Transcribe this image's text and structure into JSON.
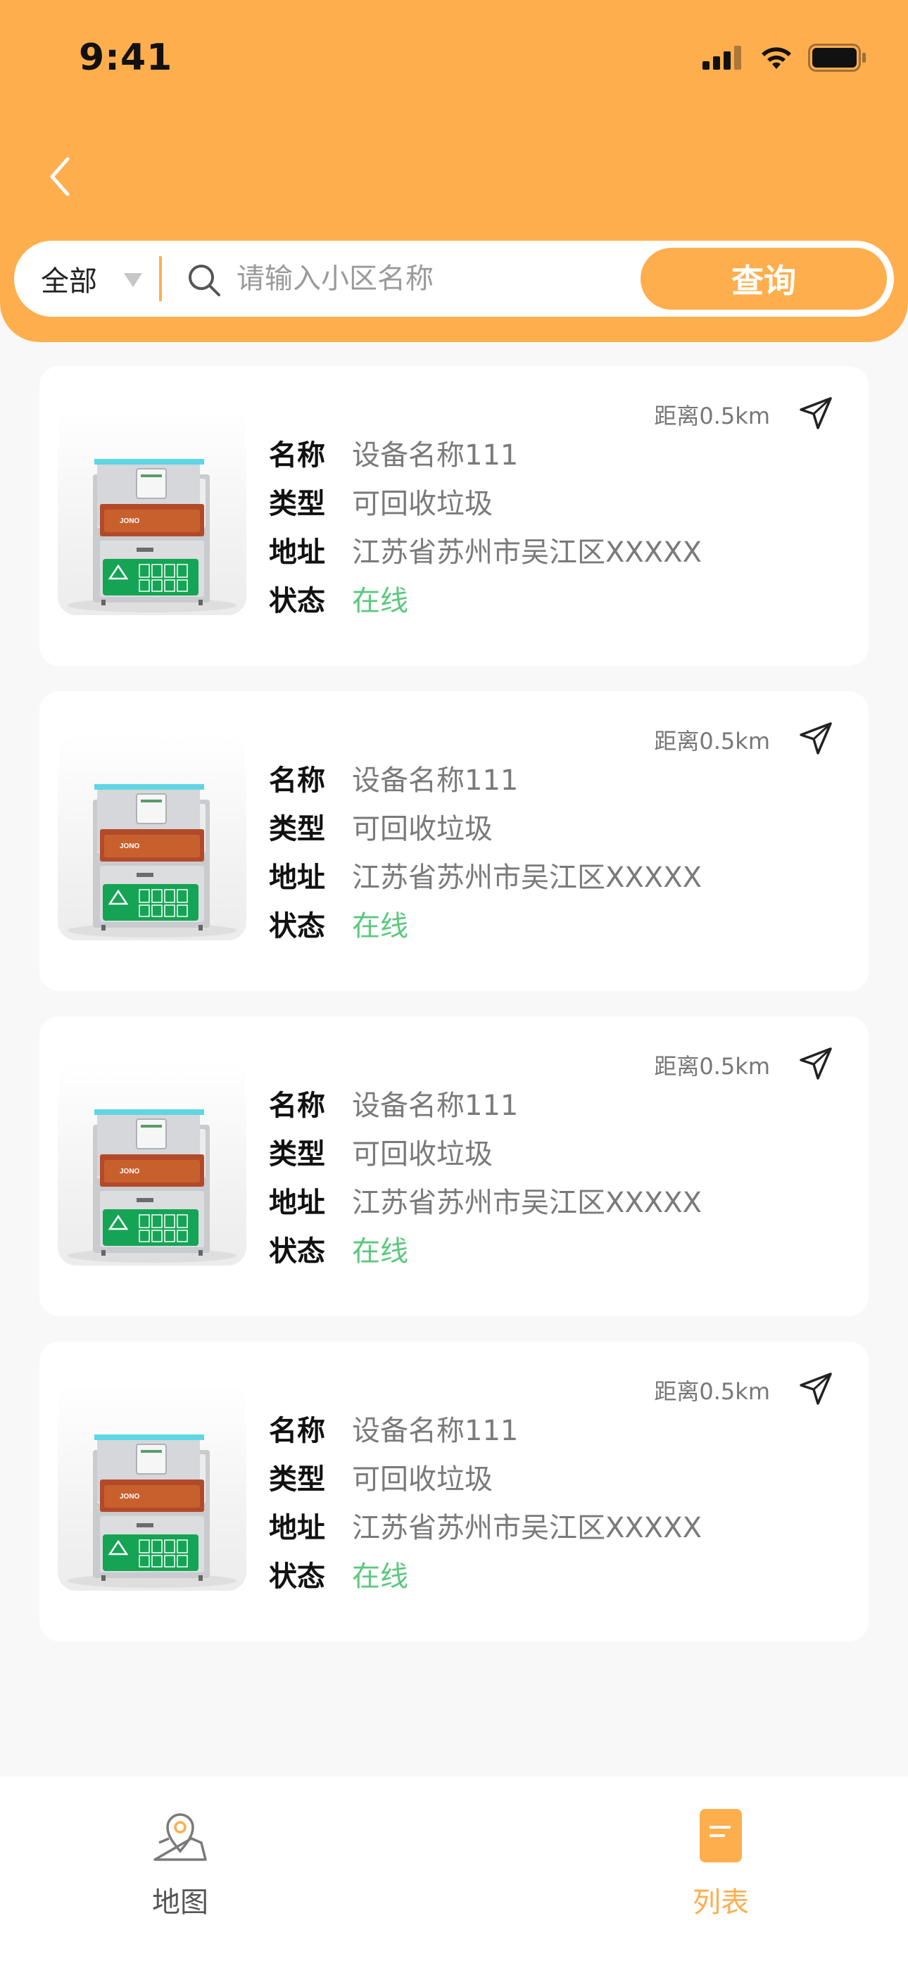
{
  "status_bar": {
    "time": "9:41"
  },
  "search": {
    "filter_label": "全部",
    "placeholder": "请输入小区名称",
    "query_label": "查询"
  },
  "labels": {
    "name": "名称",
    "type": "类型",
    "address": "地址",
    "status": "状态"
  },
  "devices": [
    {
      "distance": "距离0.5km",
      "name": "设备名称111",
      "type": "可回收垃圾",
      "address": "江苏省苏州市吴江区XXXXX",
      "status": "在线"
    },
    {
      "distance": "距离0.5km",
      "name": "设备名称111",
      "type": "可回收垃圾",
      "address": "江苏省苏州市吴江区XXXXX",
      "status": "在线"
    },
    {
      "distance": "距离0.5km",
      "name": "设备名称111",
      "type": "可回收垃圾",
      "address": "江苏省苏州市吴江区XXXXX",
      "status": "在线"
    },
    {
      "distance": "距离0.5km",
      "name": "设备名称111",
      "type": "可回收垃圾",
      "address": "江苏省苏州市吴江区XXXXX",
      "status": "在线"
    }
  ],
  "tabs": {
    "map": "地图",
    "list": "列表",
    "active": "list"
  },
  "colors": {
    "accent": "#ffae4d",
    "online": "#5cc87d",
    "background": "#f8f8f8"
  },
  "icons": {
    "back": "chevron-left-icon",
    "search": "search-icon",
    "caret": "caret-down-icon",
    "navigate": "navigation-arrow-icon",
    "map_tab": "map-pin-icon",
    "list_tab": "document-icon"
  }
}
